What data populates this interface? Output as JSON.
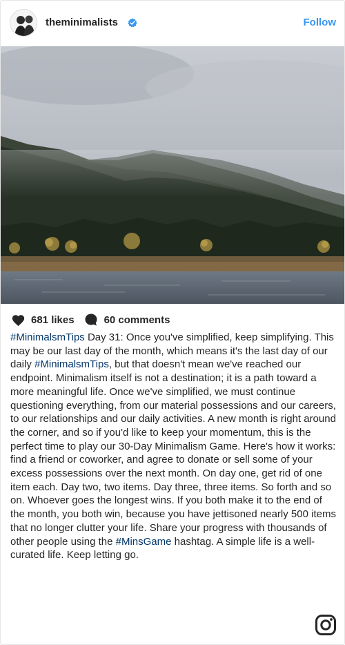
{
  "header": {
    "username": "theminimalists",
    "follow_label": "Follow"
  },
  "stats": {
    "likes": "681 likes",
    "comments": "60 comments"
  },
  "caption": {
    "tag1": "#MinimalsmTips",
    "part1": " Day 31: Once you've simplified, keep simplifying. This may be our last day of the month, which means it's the last day of our daily ",
    "tag2": "#MinimalsmTips",
    "part2": ", but that doesn't mean we've reached our endpoint. Minimalism itself is not a destination; it is a path toward a more meaningful life. Once we've simplified, we must continue questioning everything, from our material possessions and our careers, to our relationships and our daily activities. A new month is right around the corner, and so if you'd like to keep your momentum, this is the perfect time to play our 30-Day Minimalism Game. Here's how it works: find a friend or coworker, and agree to donate or sell some of your excess possessions over the next month. On day one, get rid of one item each. Day two, two items. Day three, three items. So forth and so on. Whoever goes the longest wins. If you both make it to the end of the month, you both win, because you have jettisoned nearly 500 items that no longer clutter your life. Share your progress with thousands of other people using the ",
    "tag3": "#MinsGame",
    "part3": " hashtag. A simple life is a well-curated life. Keep letting go."
  },
  "colors": {
    "link_blue": "#3897f0",
    "hashtag": "#003569",
    "text": "#262626"
  }
}
